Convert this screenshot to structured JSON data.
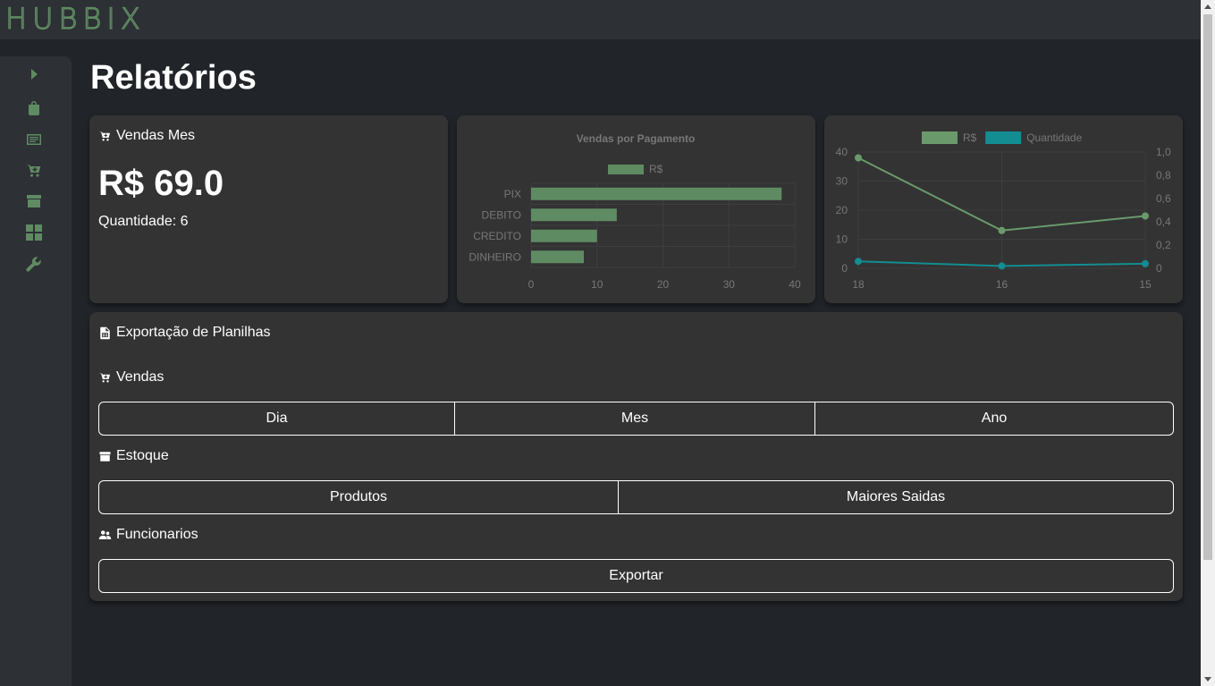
{
  "app": {
    "logo": "HUBBIX"
  },
  "sidebar": {
    "items": [
      {
        "name": "expand",
        "icon": "play-icon"
      },
      {
        "name": "products",
        "icon": "bag-icon"
      },
      {
        "name": "reports",
        "icon": "list-icon"
      },
      {
        "name": "sales",
        "icon": "cart-icon"
      },
      {
        "name": "stock",
        "icon": "archive-icon"
      },
      {
        "name": "dashboard",
        "icon": "grid-icon"
      },
      {
        "name": "settings",
        "icon": "wrench-icon"
      }
    ]
  },
  "page": {
    "title": "Relatórios"
  },
  "monthly_sales": {
    "title": "Vendas Mes",
    "icon": "cart-icon",
    "value": "R$ 69.0",
    "quantity": "Quantidade: 6"
  },
  "chart_data": [
    {
      "type": "bar",
      "orientation": "horizontal",
      "title": "Vendas por Pagamento",
      "categories": [
        "PIX",
        "DEBITO",
        "CREDITO",
        "DINHEIRO"
      ],
      "series": [
        {
          "name": "R$",
          "values": [
            38,
            13,
            10,
            8
          ]
        }
      ],
      "xlim": [
        0,
        40
      ],
      "xticks": [
        0,
        10,
        20,
        30,
        40
      ],
      "legend": "top",
      "grid": true,
      "colors": {
        "bar": "#5f8b63",
        "text": "#777777",
        "grid": "#3e3e3e"
      }
    },
    {
      "type": "line",
      "title": "",
      "x": [
        "18",
        "16",
        "15"
      ],
      "series": [
        {
          "name": "R$",
          "values": [
            38,
            13,
            18
          ],
          "axis": "left",
          "color": "#6a9a6b"
        },
        {
          "name": "Quantidade",
          "values": [
            0.06,
            0.02,
            0.04
          ],
          "axis": "right",
          "color": "#138d91"
        }
      ],
      "ylim_left": [
        0,
        40
      ],
      "yticks_left": [
        "0",
        "10",
        "20",
        "30",
        "40"
      ],
      "ylim_right": [
        0,
        1
      ],
      "yticks_right": [
        "0",
        "0,2",
        "0,4",
        "0,6",
        "0,8",
        "1,0"
      ],
      "legend": "top",
      "grid": true
    }
  ],
  "export": {
    "title": "Exportação de Planilhas",
    "icon": "spreadsheet-icon",
    "sections": {
      "sales": {
        "label": "Vendas",
        "icon": "cart-icon",
        "buttons": [
          "Dia",
          "Mes",
          "Ano"
        ]
      },
      "stock": {
        "label": "Estoque",
        "icon": "archive-icon",
        "buttons": [
          "Produtos",
          "Maiores Saidas"
        ]
      },
      "employees": {
        "label": "Funcionarios",
        "icon": "users-icon",
        "buttons": [
          "Exportar"
        ]
      }
    }
  }
}
